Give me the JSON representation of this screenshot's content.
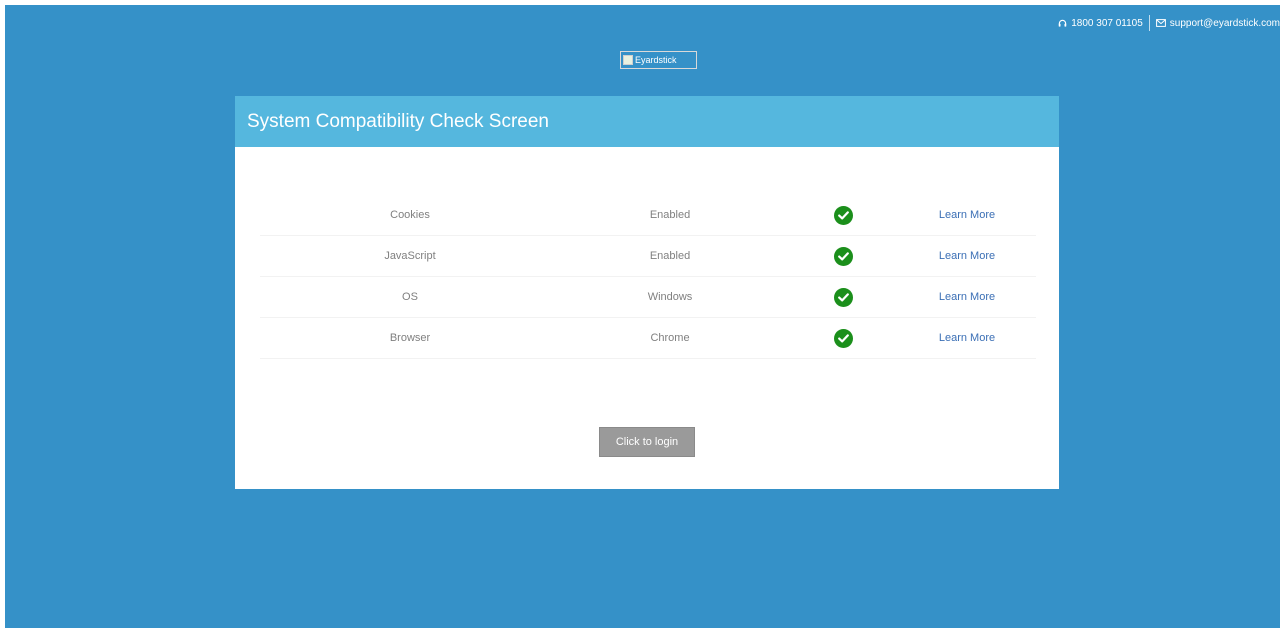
{
  "contact": {
    "phone": "1800 307 01105",
    "email": "support@eyardstick.com",
    "phone_icon": "headset-icon",
    "email_icon": "envelope-icon"
  },
  "logo": {
    "alt_text": "Eyardstick"
  },
  "card": {
    "title": "System Compatibility Check Screen",
    "rows": [
      {
        "name": "Cookies",
        "status": "Enabled",
        "icon": "check-circle-icon",
        "link": "Learn More"
      },
      {
        "name": "JavaScript",
        "status": "Enabled",
        "icon": "check-circle-icon",
        "link": "Learn More"
      },
      {
        "name": "OS",
        "status": "Windows",
        "icon": "check-circle-icon",
        "link": "Learn More"
      },
      {
        "name": "Browser",
        "status": "Chrome",
        "icon": "check-circle-icon",
        "link": "Learn More"
      }
    ],
    "login_button": "Click to login"
  },
  "colors": {
    "background": "#3591c8",
    "header": "#55b7de",
    "check": "#1b8f1b",
    "link": "#3b6fb5",
    "button": "#9a9a9a"
  }
}
